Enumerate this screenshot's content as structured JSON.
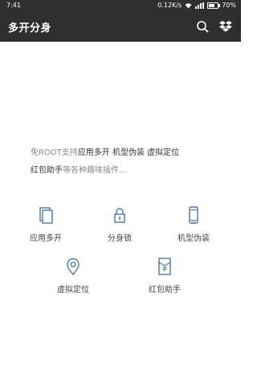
{
  "status": {
    "time": "7:41",
    "speed": "0.12K/s",
    "battery": "70%"
  },
  "app": {
    "title": "多开分身",
    "search_icon": "search-icon",
    "dropbox_icon": "dropbox-icon"
  },
  "intro": {
    "p1": "免ROOT支持",
    "p2": "应用多开 机型伪装 虚拟定位",
    "p3": "红包助手",
    "p4": "等各种趣味插件..."
  },
  "features": [
    {
      "label": "应用多开",
      "icon": "app-clone-icon"
    },
    {
      "label": "分身锁",
      "icon": "lock-icon"
    },
    {
      "label": "机型伪装",
      "icon": "phone-disguise-icon"
    },
    {
      "label": "虚拟定位",
      "icon": "location-icon"
    },
    {
      "label": "红包助手",
      "icon": "red-envelope-icon"
    }
  ],
  "colors": {
    "header_bg": "#2f2f2f",
    "icon_blue": "#4a78a8"
  }
}
